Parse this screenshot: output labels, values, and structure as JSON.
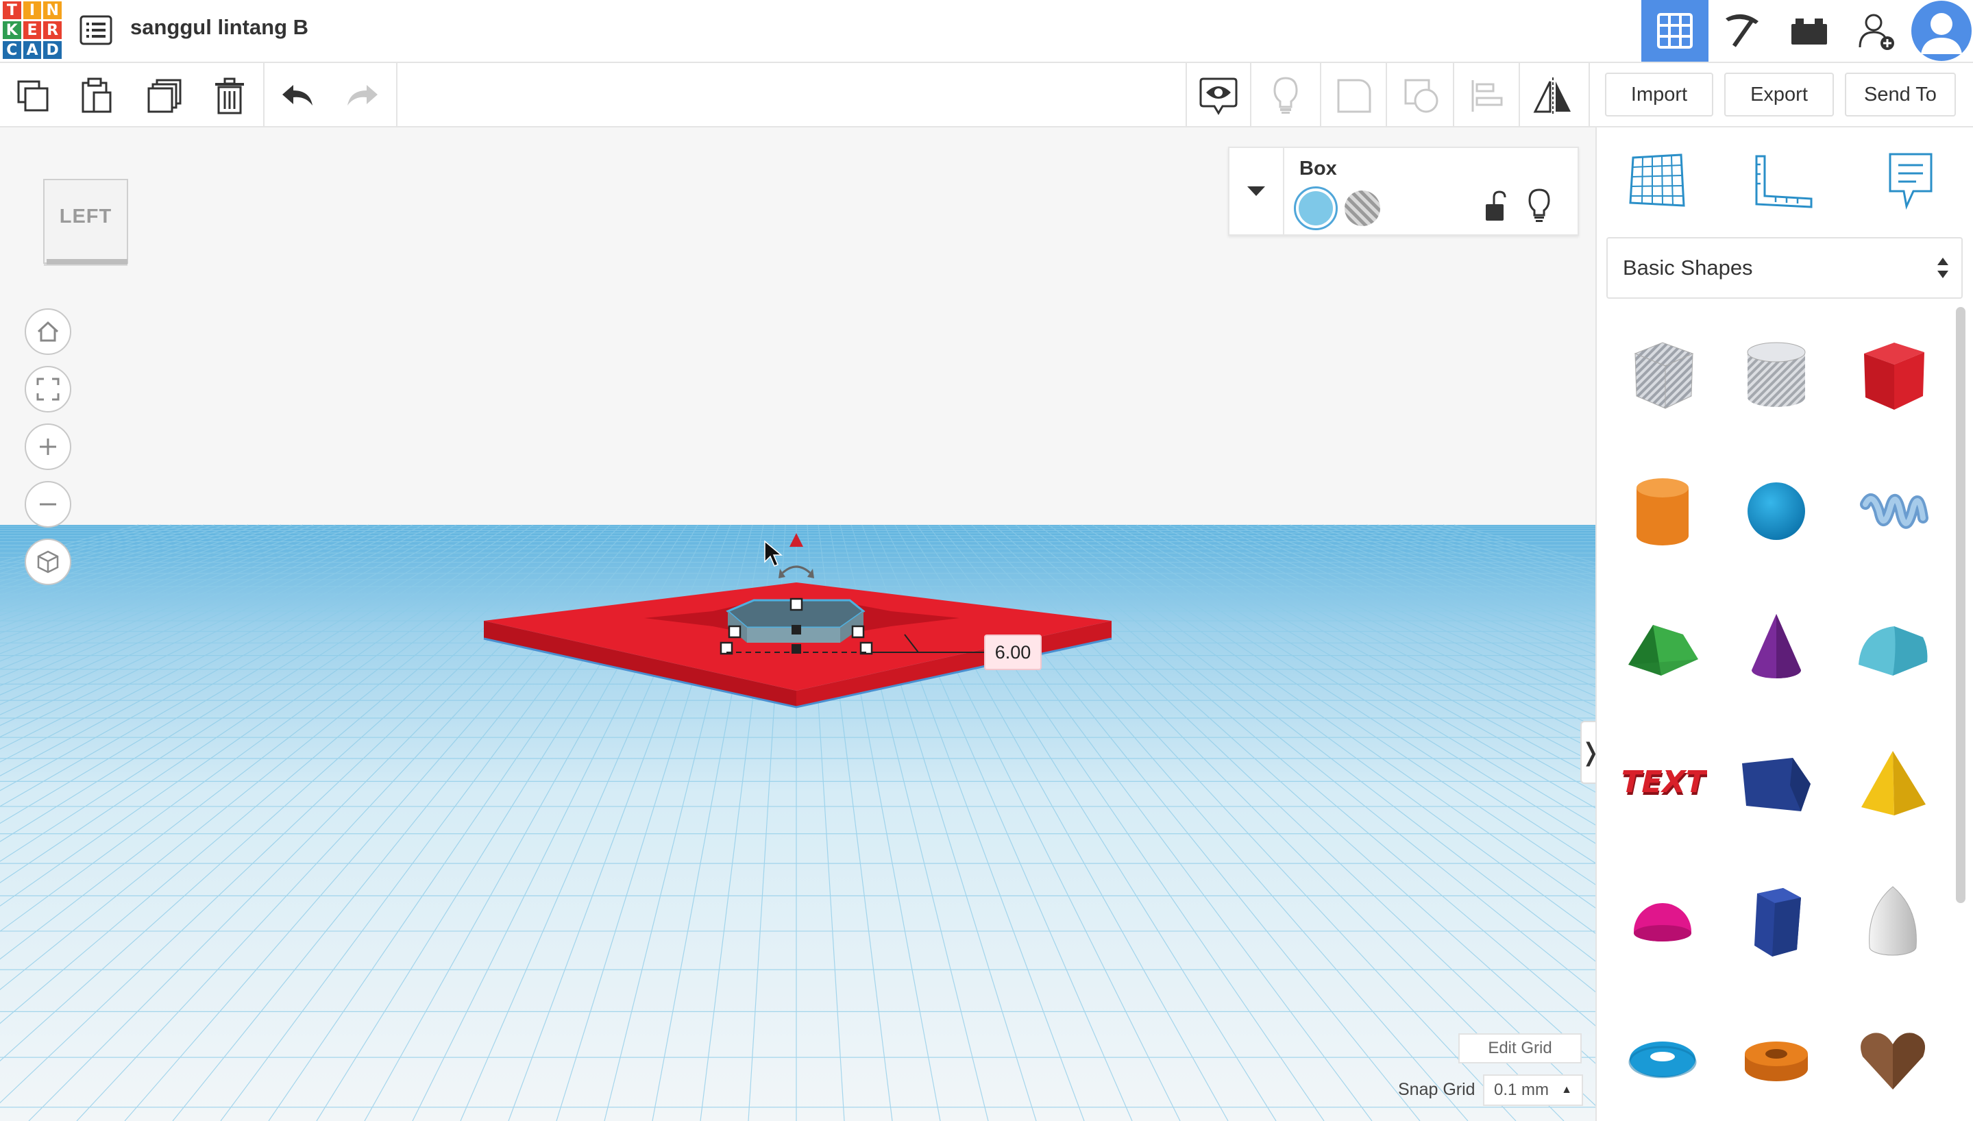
{
  "header": {
    "logo_letters": [
      "T",
      "I",
      "N",
      "K",
      "E",
      "R",
      "C",
      "A",
      "D"
    ],
    "logo_colors": [
      "#e8402f",
      "#f5a21b",
      "#f5a21b",
      "#2f9d52",
      "#e8402f",
      "#e8402f",
      "#1f6dad",
      "#1f6dad",
      "#1f6dad"
    ],
    "design_title": "sanggul lintang B"
  },
  "toolbar": {
    "import_label": "Import",
    "export_label": "Export",
    "send_to_label": "Send To"
  },
  "viewcube": {
    "face_label": "LEFT"
  },
  "inspector": {
    "shape_name": "Box",
    "solid_color": "#7ec8e8"
  },
  "workplane": {
    "dimension_value": "6.00",
    "edit_grid_label": "Edit Grid",
    "snap_grid_label": "Snap Grid",
    "snap_grid_value": "0.1 mm"
  },
  "panel": {
    "category": "Basic Shapes",
    "shapes": [
      {
        "name": "box-hole",
        "color": "#b8bcc4"
      },
      {
        "name": "cylinder-hole",
        "color": "#c4c7cc"
      },
      {
        "name": "box",
        "color": "#d0202c"
      },
      {
        "name": "cylinder",
        "color": "#e8801e"
      },
      {
        "name": "sphere",
        "color": "#1a9ad6"
      },
      {
        "name": "scribble",
        "color": "#8ab6dd"
      },
      {
        "name": "roof",
        "color": "#2f9a3c"
      },
      {
        "name": "cone",
        "color": "#7a2b9a"
      },
      {
        "name": "round-roof",
        "color": "#5ec1d6"
      },
      {
        "name": "text",
        "color": "#c8202a"
      },
      {
        "name": "polygon",
        "color": "#25408f"
      },
      {
        "name": "pyramid",
        "color": "#f2c318"
      },
      {
        "name": "half-sphere",
        "color": "#e0168c"
      },
      {
        "name": "hexagonal-prism",
        "color": "#28449a"
      },
      {
        "name": "paraboloid",
        "color": "#d8d8d8"
      },
      {
        "name": "torus",
        "color": "#1a9ad6"
      },
      {
        "name": "tube",
        "color": "#e8801e"
      },
      {
        "name": "heart",
        "color": "#8a5a3a"
      }
    ]
  },
  "colors": {
    "accent": "#4f8ee6",
    "workplane_grid": "#7cc4e6",
    "design_red": "#e51f2c"
  }
}
